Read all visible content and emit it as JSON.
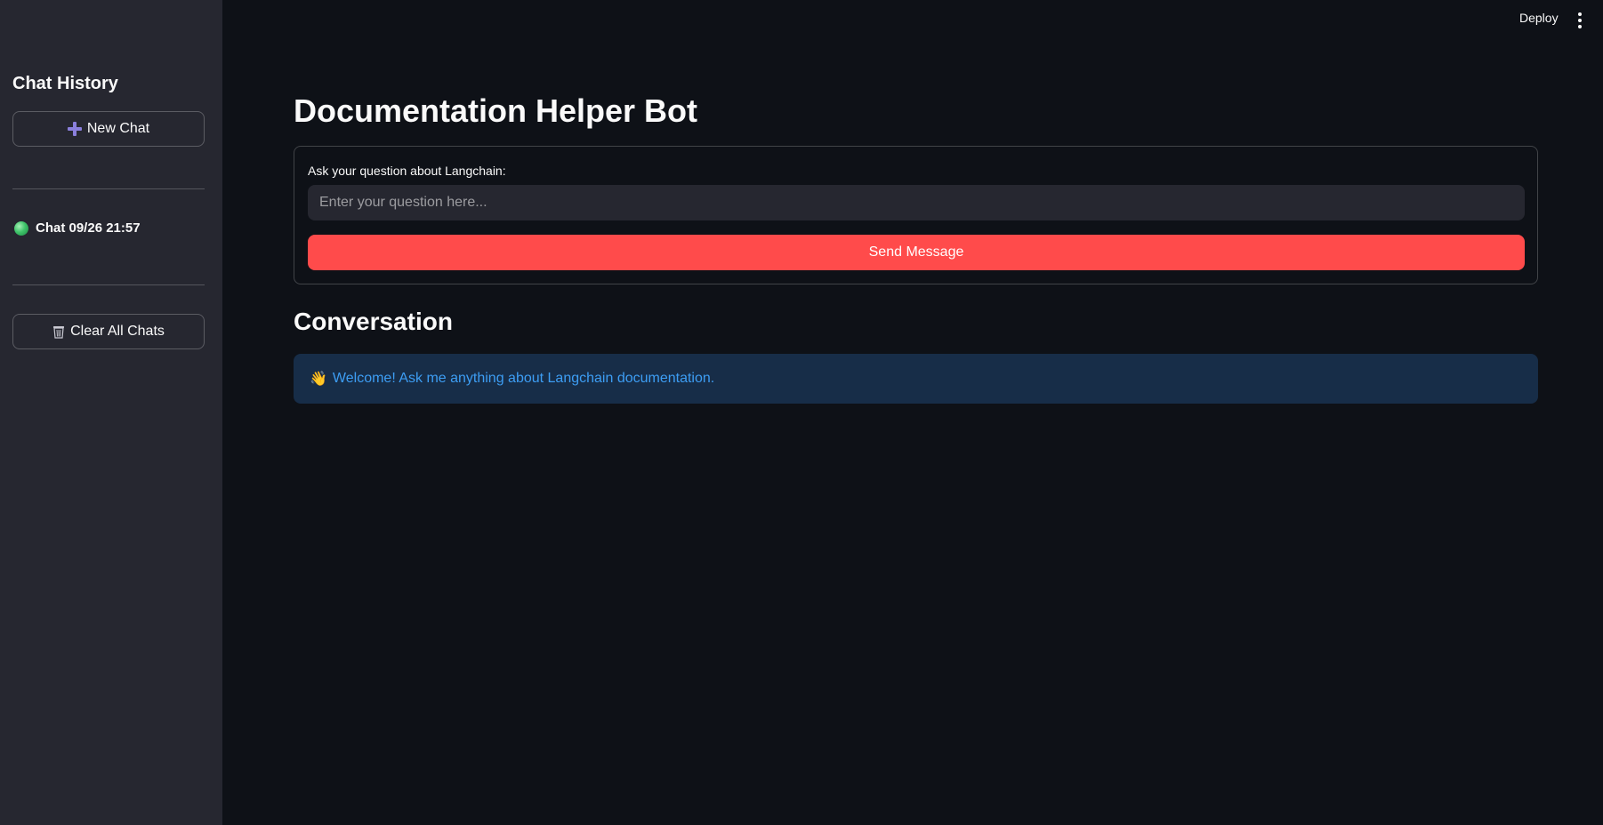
{
  "sidebar": {
    "title": "Chat History",
    "new_chat_label": "New Chat",
    "new_chat_icon": "plus-icon",
    "chats": [
      {
        "label": "Chat 09/26 21:57",
        "status_icon": "green-circle-icon",
        "status_color": "#3fc46a"
      }
    ],
    "clear_label": "Clear All Chats",
    "clear_icon": "wastebasket-icon"
  },
  "header": {
    "deploy_label": "Deploy",
    "menu_icon": "vertical-dots-icon"
  },
  "main": {
    "title": "Documentation Helper Bot",
    "form": {
      "label": "Ask your question about Langchain:",
      "input_value": "",
      "input_placeholder": "Enter your question here...",
      "send_label": "Send Message"
    },
    "conversation": {
      "title": "Conversation",
      "welcome_emoji": "👋",
      "welcome_text": "Welcome! Ask me anything about Langchain documentation."
    }
  },
  "colors": {
    "background": "#0e1117",
    "sidebar": "#262730",
    "accent": "#ff4b4b",
    "info_bg": "#172d48",
    "info_text": "#3d9df3"
  }
}
